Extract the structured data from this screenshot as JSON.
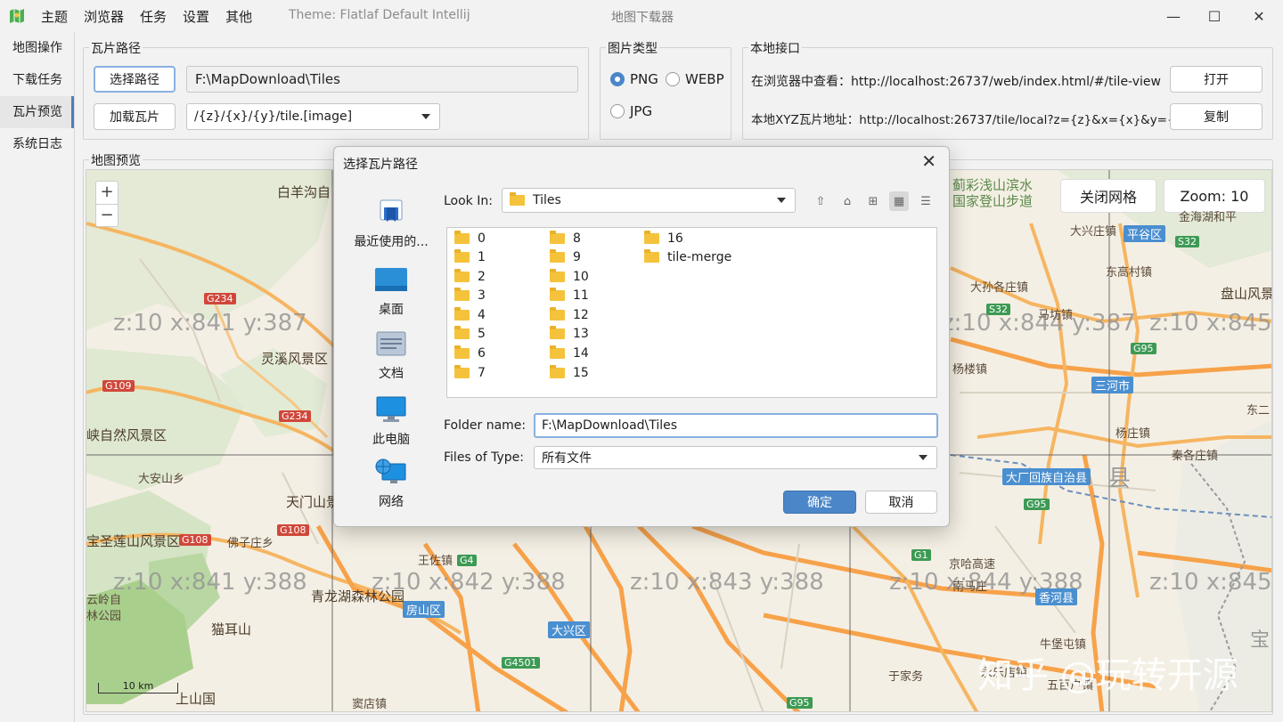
{
  "titlebar": {
    "menu": [
      "主题",
      "浏览器",
      "任务",
      "设置",
      "其他"
    ],
    "theme": "Theme: Flatlaf Default Intellij",
    "title": "地图下载器",
    "minimize": "—",
    "maximize": "☐",
    "close": "✕"
  },
  "nav": [
    "地图操作",
    "下载任务",
    "瓦片预览",
    "系统日志"
  ],
  "tile_path": {
    "group_title": "瓦片路径",
    "choose_btn": "选择路径",
    "path_value": "F:\\MapDownload\\Tiles",
    "load_btn": "加载瓦片",
    "pattern_value": "/{z}/{x}/{y}/tile.[image]"
  },
  "image_type": {
    "group_title": "图片类型",
    "options": [
      "PNG",
      "WEBP",
      "JPG"
    ],
    "selected": "PNG"
  },
  "local_api": {
    "group_title": "本地接口",
    "browser_text": "在浏览器中查看：http://localhost:26737/web/index.html/#/tile-view",
    "open_btn": "打开",
    "xyz_text": "本地XYZ瓦片地址：http://localhost:26737/tile/local?z={z}&x={x}&y={y}",
    "copy_btn": "复制"
  },
  "map_preview": {
    "group_title": "地图预览",
    "zoom_in": "+",
    "zoom_out": "−",
    "close_grid_btn": "关闭网格",
    "zoom_label": "Zoom: 10",
    "scale": "10 km",
    "tiles": [
      "z:10 x:841 y:387",
      "z:10 x:844 y:387",
      "z:10 x:845",
      "z:10 x:841 y:388",
      "z:10 x:842 y:388",
      "z:10 x:843 y:388",
      "z:10 x:844 y:388",
      "z:10 x:845"
    ],
    "places": [
      "白羊沟自",
      "灵溪风景区",
      "峡自然风景区",
      "大安山乡",
      "天门山景",
      "宝圣莲山风景区",
      "佛子庄乡",
      "云岭自",
      "林公园",
      "猫耳山",
      "青龙湖森林公园",
      "王佐镇",
      "房山区",
      "大兴区",
      "上山国",
      "窦店镇",
      "蓟彩浅山滨水",
      "国家登山步道",
      "大兴庄镇",
      "平谷区",
      "大孙各庄镇",
      "东高村镇",
      "盘山风景",
      "马坊镇",
      "三河市",
      "杨楼镇",
      "东二",
      "杨庄镇",
      "大厂回族自治县",
      "县",
      "宝",
      "秦各庄镇",
      "香河县",
      "牛堡屯镇",
      "永乐店镇",
      "于家务",
      "京哈高速",
      "南马庄",
      "金海湖和平",
      "五百户镇"
    ],
    "roads": [
      "G234",
      "G109",
      "G234",
      "G108",
      "G108",
      "G4",
      "G4501",
      "G95",
      "S32",
      "S32",
      "G95",
      "G1",
      "G95"
    ],
    "watermark": "知乎 @玩转开源"
  },
  "dialog": {
    "title": "选择瓦片路径",
    "close": "✕",
    "shortcuts": [
      "最近使用的...",
      "桌面",
      "文档",
      "此电脑",
      "网络"
    ],
    "look_in_label": "Look In:",
    "look_in_value": "Tiles",
    "folders_col1": [
      "0",
      "1",
      "2",
      "3",
      "4",
      "5",
      "6",
      "7"
    ],
    "folders_col2": [
      "8",
      "9",
      "10",
      "11",
      "12",
      "13",
      "14",
      "15"
    ],
    "folders_col3": [
      "16",
      "tile-merge"
    ],
    "folder_name_label": "Folder name:",
    "folder_name_value": "F:\\MapDownload\\Tiles",
    "files_of_type_label": "Files of Type:",
    "files_of_type_value": "所有文件",
    "ok_btn": "确定",
    "cancel_btn": "取消"
  }
}
